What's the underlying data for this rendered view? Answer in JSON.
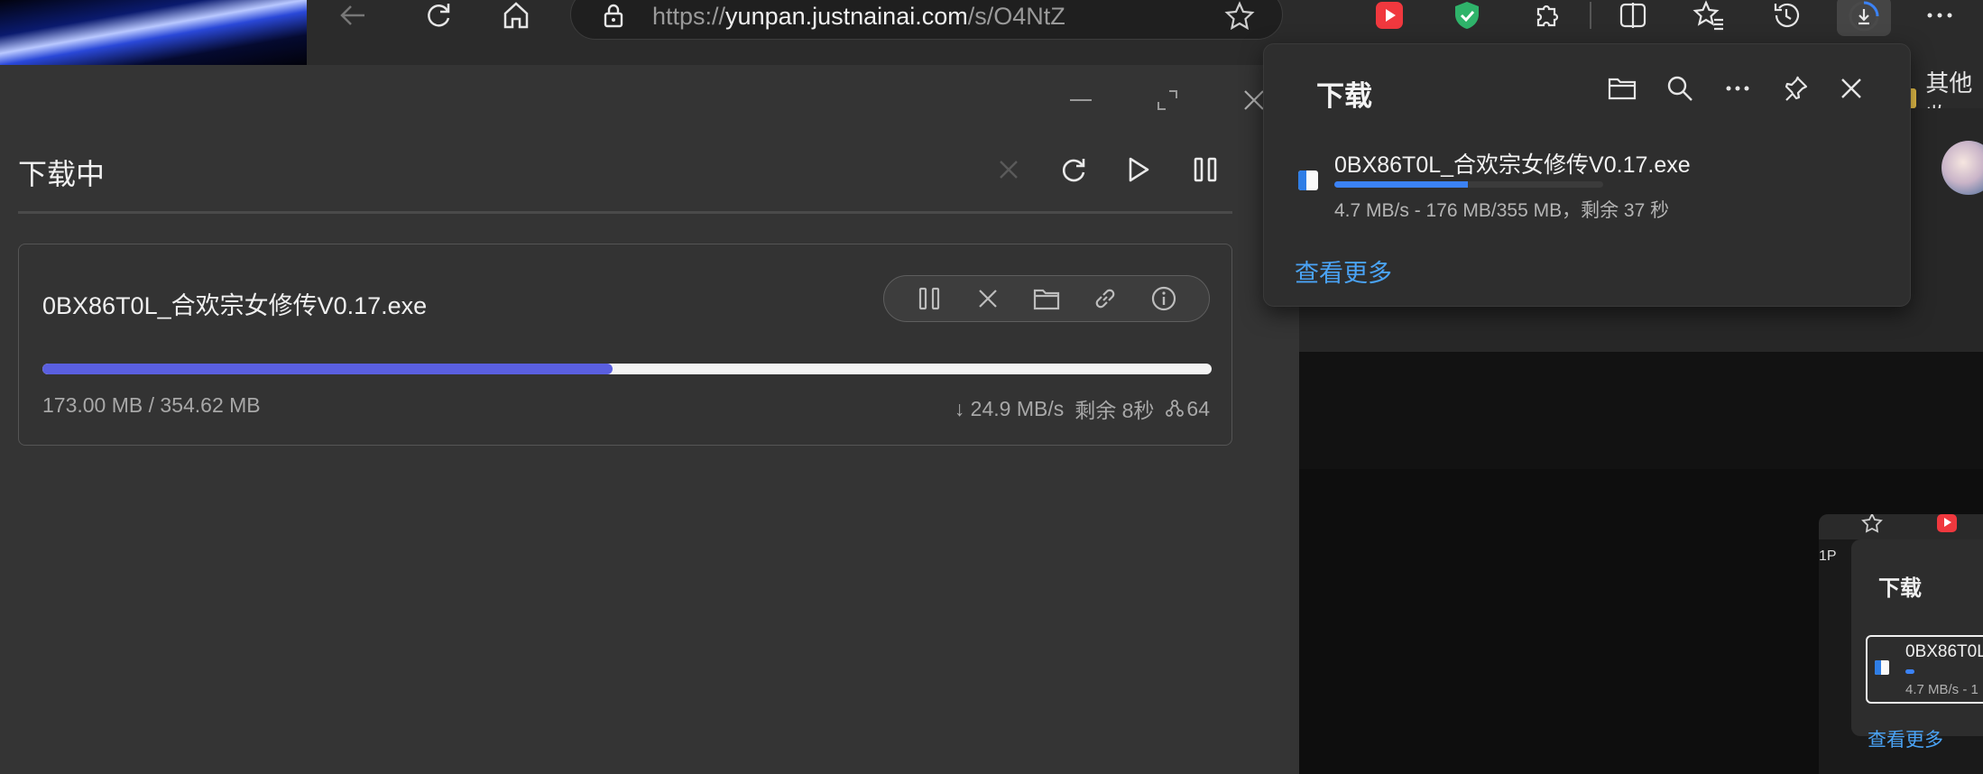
{
  "browser": {
    "url_scheme": "https://",
    "url_host": "yunpan.justnainai.com",
    "url_path": "/s/O4NtZ",
    "bookmark_other": "其他收",
    "icons": [
      "back-arrow-icon",
      "refresh-icon",
      "home-icon",
      "lock-icon",
      "star-icon",
      "video-ext-icon",
      "shield-ext-icon",
      "extensions-icon",
      "split-screen-icon",
      "favorites-icon",
      "history-icon",
      "downloads-icon",
      "more-icon"
    ]
  },
  "app": {
    "title": "下载中",
    "task": {
      "name": "0BX86T0L_合欢宗女修传V0.17.exe",
      "progress": 0.488,
      "size": "173.00 MB / 354.62 MB",
      "speed": "↓ 24.9 MB/s",
      "remaining": "剩余 8秒",
      "peers": "64"
    },
    "accent": "#5a5fe0"
  },
  "flyout": {
    "title": "下载",
    "file_name": "0BX86T0L_合欢宗女修传V0.17.exe",
    "progress": 0.496,
    "status": "4.7 MB/s - 176 MB/355 MB，剩余 37 秒",
    "more_link": "查看更多",
    "accent": "#3b82f6"
  },
  "mini": {
    "bookmark": "1P",
    "title": "下载",
    "file_name": "0BX86T0L",
    "status": "4.7 MB/s - 1",
    "more_link": "查看更多"
  }
}
